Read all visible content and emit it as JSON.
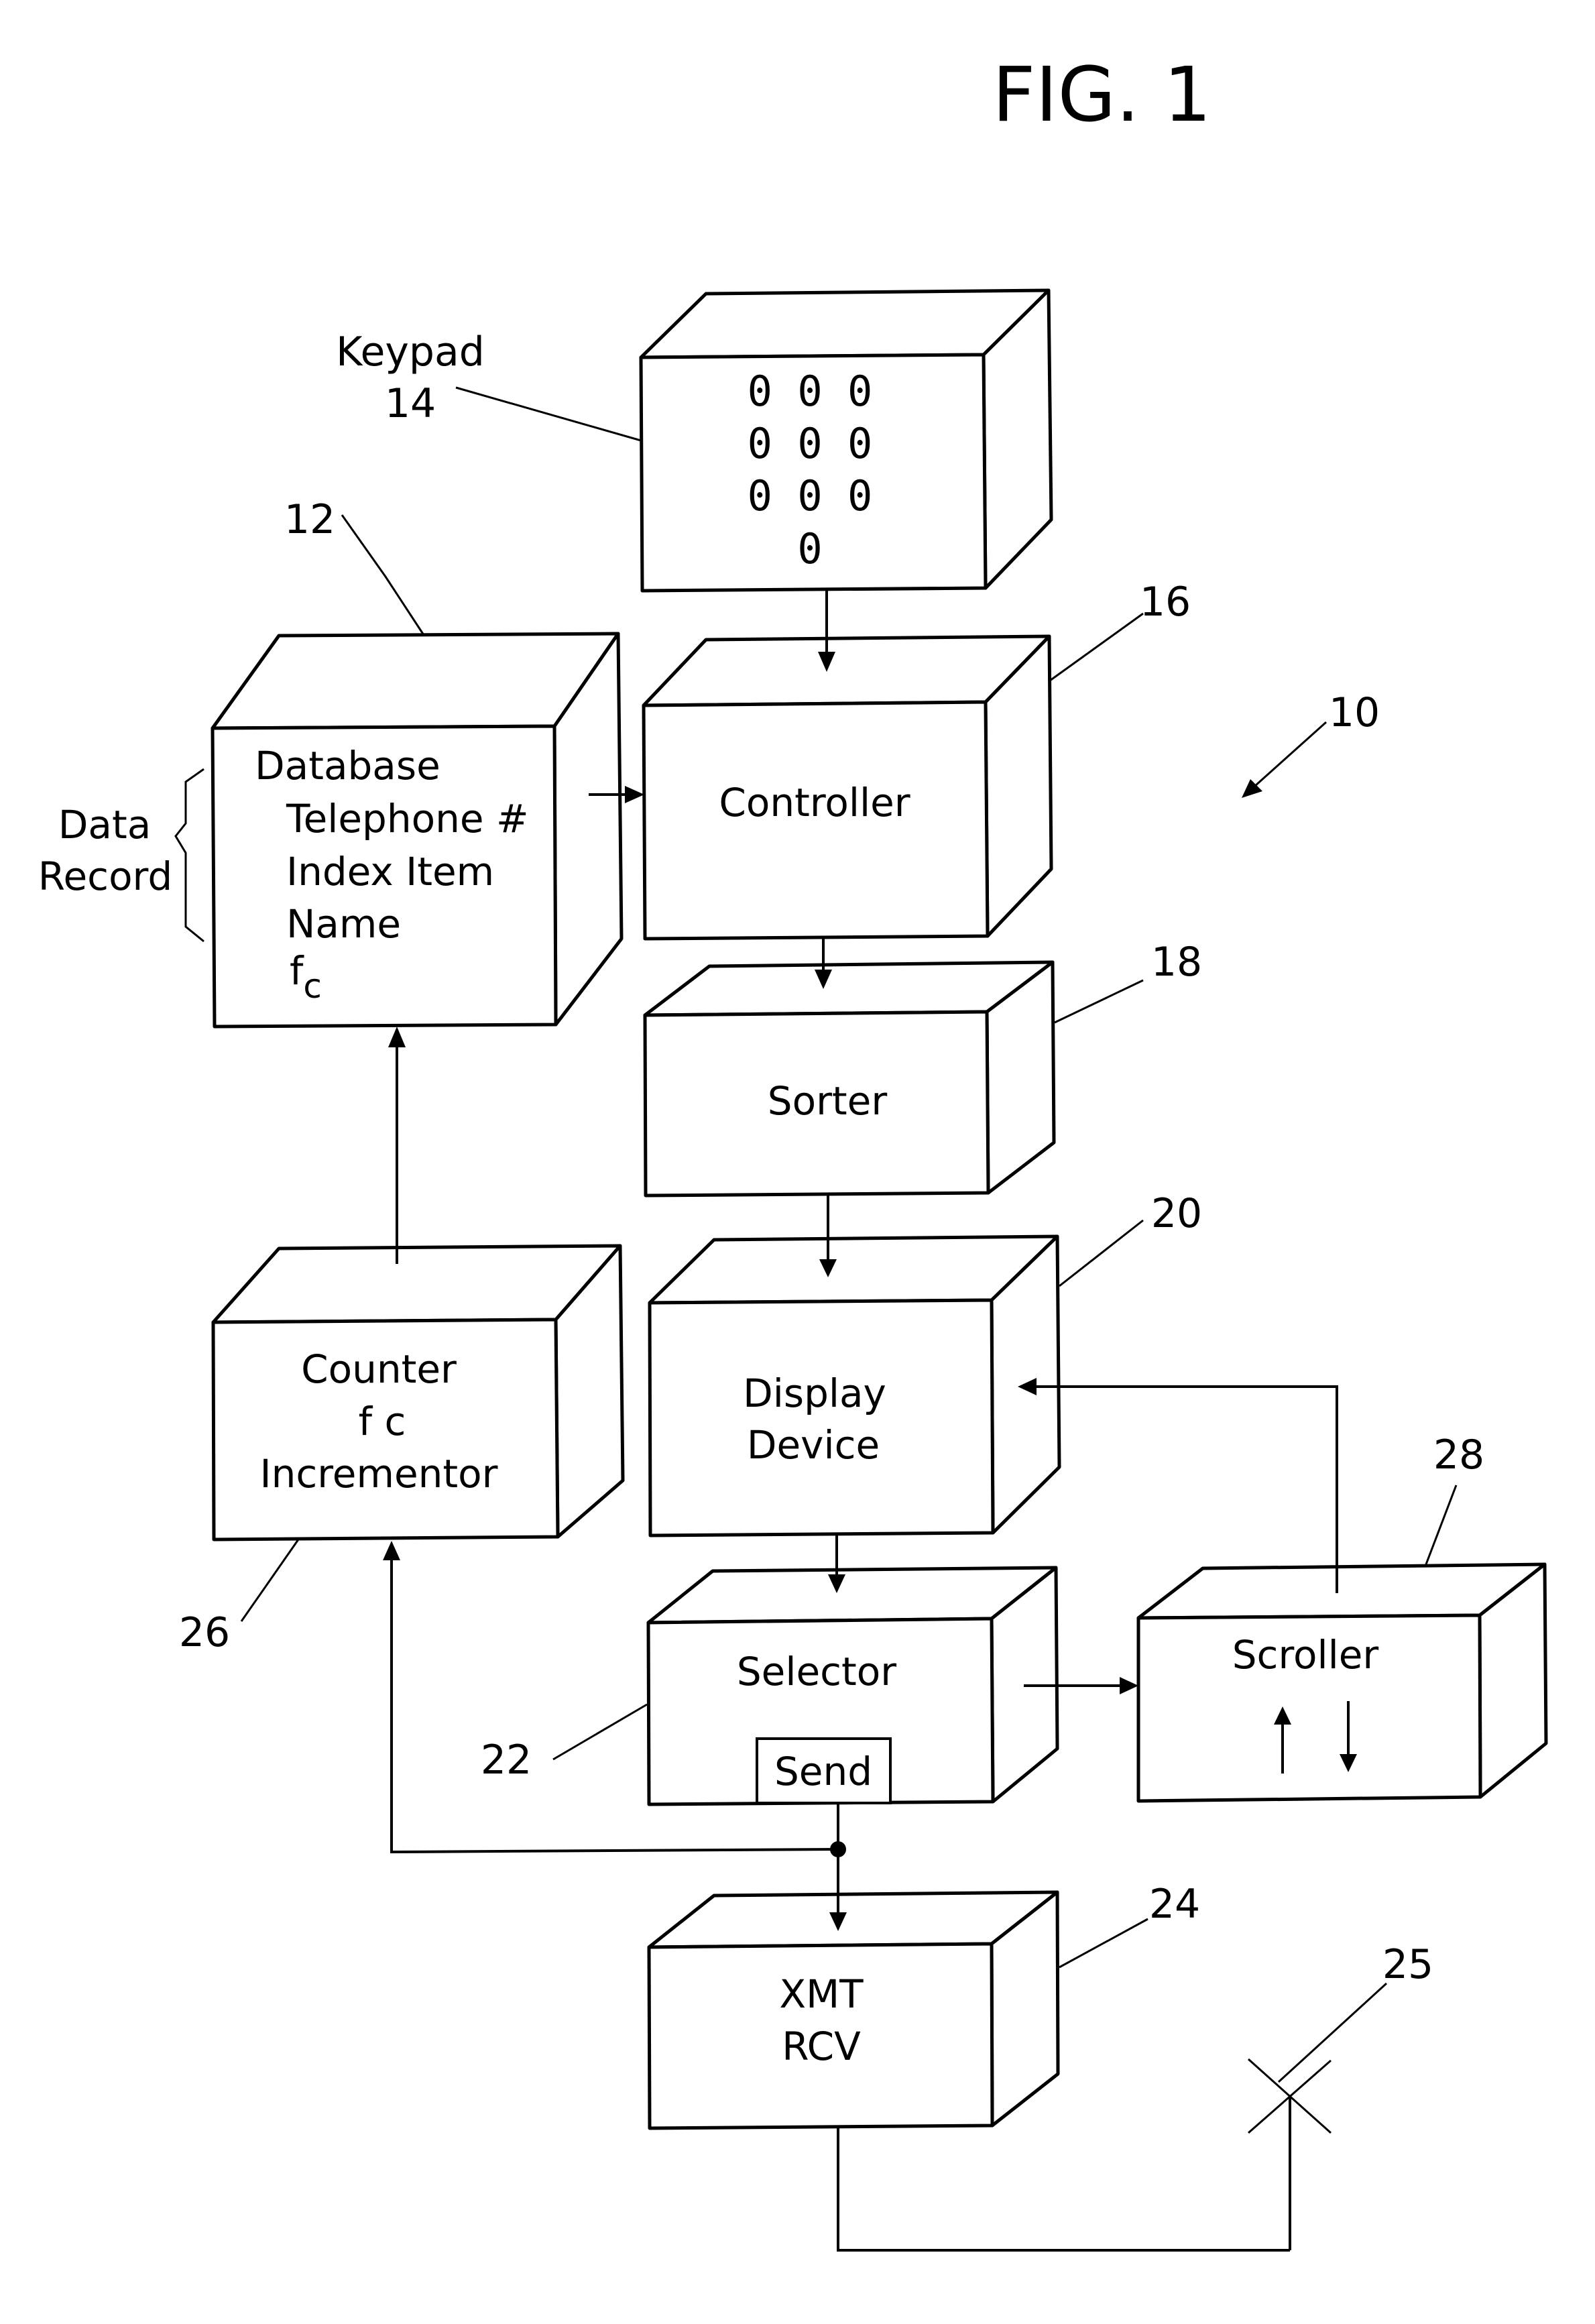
{
  "figure": {
    "title": "FIG. 1",
    "system_ref": "10"
  },
  "blocks": {
    "keypad": {
      "label_line1": "Keypad",
      "label_line2": "14",
      "keys": [
        "0 0 0",
        "0 0 0",
        "0 0 0",
        "0"
      ]
    },
    "database": {
      "ref": "12",
      "title": "Database",
      "fields": [
        "Telephone #",
        "Index Item",
        "Name",
        "f"
      ],
      "fc_subscript": "c",
      "bracket_label_line1": "Data",
      "bracket_label_line2": "Record"
    },
    "controller": {
      "ref": "16",
      "label": "Controller"
    },
    "sorter": {
      "ref": "18",
      "label": "Sorter"
    },
    "display": {
      "ref": "20",
      "label_line1": "Display",
      "label_line2": "Device"
    },
    "counter": {
      "ref": "26",
      "label_line1": "Counter",
      "label_line2": "f c",
      "label_line3": "Incrementor"
    },
    "selector": {
      "ref": "22",
      "label": "Selector",
      "send_button": "Send"
    },
    "scroller": {
      "ref": "28",
      "label": "Scroller",
      "up_icon": "arrow-up",
      "down_icon": "arrow-down"
    },
    "transceiver": {
      "ref": "24",
      "label_line1": "XMT",
      "label_line2": "RCV"
    },
    "antenna": {
      "ref": "25"
    }
  }
}
